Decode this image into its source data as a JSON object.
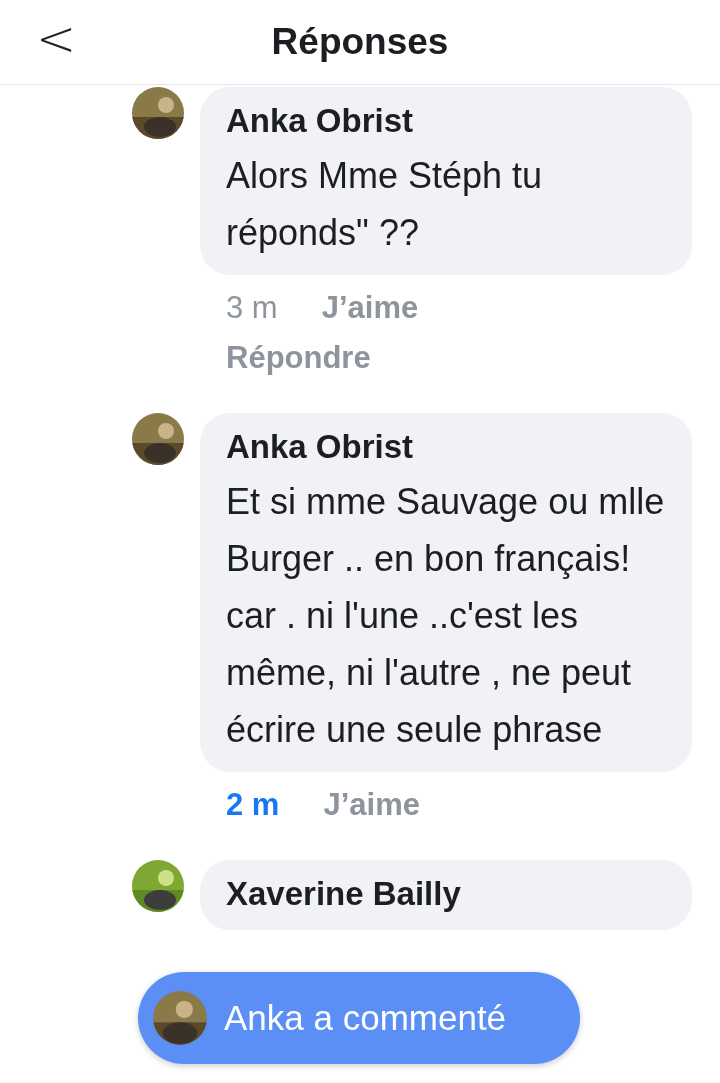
{
  "header": {
    "back": "<",
    "title": "Réponses"
  },
  "comments": [
    {
      "author": "Anka Obrist",
      "text": "Alors Mme Stéph tu réponds\" ??",
      "time": "3 m",
      "recent": false,
      "like": "J’aime",
      "reply": "Répondre"
    },
    {
      "author": "Anka Obrist",
      "text": "Et si mme Sauvage ou mlle Burger .. en bon français! car . ni l'une ..c'est les même, ni l'autre , ne peut écrire une seule phrase",
      "time": "2 m",
      "recent": true,
      "like": "J’aime"
    },
    {
      "author": "Xaverine Bailly"
    }
  ],
  "toast": {
    "text": "Anka a commenté"
  }
}
